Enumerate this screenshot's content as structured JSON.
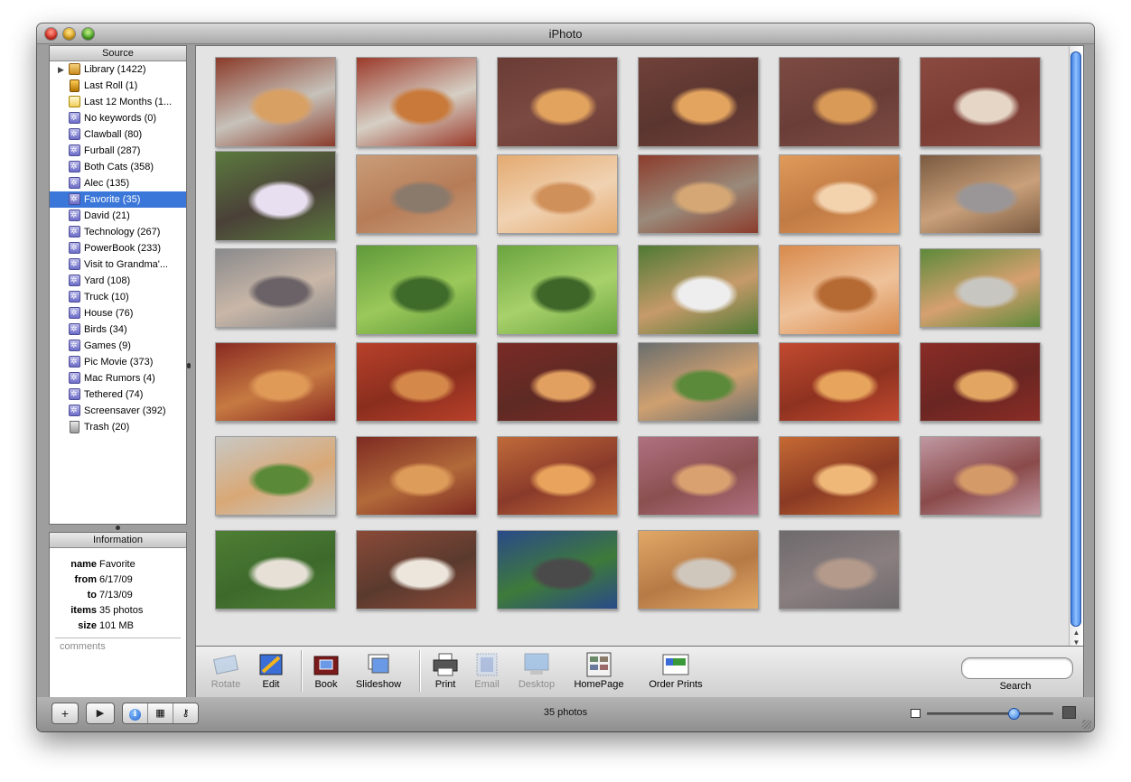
{
  "window": {
    "title": "iPhoto"
  },
  "source": {
    "header": "Source",
    "items": [
      {
        "label": "Library (1422)",
        "icon": "library-icon",
        "kind": "library"
      },
      {
        "label": "Last Roll (1)",
        "icon": "film-roll-icon",
        "kind": "roll"
      },
      {
        "label": "Last 12 Months (1...",
        "icon": "calendar-icon",
        "kind": "calendar"
      },
      {
        "label": "No keywords (0)",
        "icon": "smart-album-icon",
        "kind": "album"
      },
      {
        "label": "Clawball (80)",
        "icon": "smart-album-icon",
        "kind": "album"
      },
      {
        "label": "Furball (287)",
        "icon": "smart-album-icon",
        "kind": "album"
      },
      {
        "label": "Both Cats (358)",
        "icon": "smart-album-icon",
        "kind": "album"
      },
      {
        "label": "Alec (135)",
        "icon": "smart-album-icon",
        "kind": "album"
      },
      {
        "label": "Favorite (35)",
        "icon": "smart-album-icon",
        "kind": "album",
        "selected": true
      },
      {
        "label": "David (21)",
        "icon": "smart-album-icon",
        "kind": "album"
      },
      {
        "label": "Technology (267)",
        "icon": "smart-album-icon",
        "kind": "album"
      },
      {
        "label": "PowerBook (233)",
        "icon": "smart-album-icon",
        "kind": "album"
      },
      {
        "label": "Visit to Grandma'...",
        "icon": "smart-album-icon",
        "kind": "album"
      },
      {
        "label": "Yard (108)",
        "icon": "smart-album-icon",
        "kind": "album"
      },
      {
        "label": "Truck (10)",
        "icon": "smart-album-icon",
        "kind": "album"
      },
      {
        "label": "House (76)",
        "icon": "smart-album-icon",
        "kind": "album"
      },
      {
        "label": "Birds (34)",
        "icon": "smart-album-icon",
        "kind": "album"
      },
      {
        "label": "Games (9)",
        "icon": "smart-album-icon",
        "kind": "album"
      },
      {
        "label": "Pic Movie (373)",
        "icon": "smart-album-icon",
        "kind": "album"
      },
      {
        "label": "Mac Rumors (4)",
        "icon": "smart-album-icon",
        "kind": "album"
      },
      {
        "label": "Tethered (74)",
        "icon": "smart-album-icon",
        "kind": "album"
      },
      {
        "label": "Screensaver (392)",
        "icon": "smart-album-icon",
        "kind": "album"
      },
      {
        "label": "Trash (20)",
        "icon": "trash-icon",
        "kind": "trash"
      }
    ]
  },
  "information": {
    "header": "Information",
    "rows": [
      {
        "label": "name",
        "value": "Favorite"
      },
      {
        "label": "from",
        "value": "6/17/09"
      },
      {
        "label": "to",
        "value": "7/13/09"
      },
      {
        "label": "items",
        "value": "35 photos"
      },
      {
        "label": "size",
        "value": "101 MB"
      }
    ],
    "comments_placeholder": "comments"
  },
  "photos": {
    "count": 35,
    "thumbnails": [
      {
        "name": "photo-01",
        "subject": "orange cat on brick steps",
        "colors": [
          "#8a3b2a",
          "#d9a064",
          "#c7c2ba"
        ]
      },
      {
        "name": "photo-02",
        "subject": "orange cat on porch steps",
        "colors": [
          "#9b3a2a",
          "#c97a3a",
          "#d6cfc4"
        ]
      },
      {
        "name": "photo-03",
        "subject": "orange cat lying on deck",
        "colors": [
          "#6a3c35",
          "#e2a35e",
          "#7b4a42"
        ]
      },
      {
        "name": "photo-04",
        "subject": "orange cat stretching on deck",
        "colors": [
          "#70423a",
          "#e3a45f",
          "#5a352f"
        ]
      },
      {
        "name": "photo-05",
        "subject": "orange cat lying on deck",
        "colors": [
          "#7c4b43",
          "#d99a57",
          "#6a3e37"
        ]
      },
      {
        "name": "photo-06",
        "subject": "cat lying on red deck",
        "colors": [
          "#8a4a40",
          "#e6d6c6",
          "#7b3c34"
        ]
      },
      {
        "name": "photo-07",
        "subject": "boy holding gray cat",
        "colors": [
          "#5b7a3e",
          "#e8dff0",
          "#4a4038"
        ]
      },
      {
        "name": "photo-08",
        "subject": "gray cat by window blinds",
        "colors": [
          "#c99d78",
          "#8a7a6c",
          "#b67c58"
        ]
      },
      {
        "name": "photo-09",
        "subject": "orange cat closeup",
        "colors": [
          "#e4aa70",
          "#d0905a",
          "#f0d2b2"
        ]
      },
      {
        "name": "photo-10",
        "subject": "orange cat by brick wall",
        "colors": [
          "#8c3c2c",
          "#d5a774",
          "#9a8a7a"
        ]
      },
      {
        "name": "photo-11",
        "subject": "orange cat face closeup",
        "colors": [
          "#e09a5a",
          "#f3d2ae",
          "#c07a44"
        ]
      },
      {
        "name": "photo-12",
        "subject": "gray cat near patio chair",
        "colors": [
          "#7a5a40",
          "#9a9698",
          "#c9a07a"
        ]
      },
      {
        "name": "photo-13",
        "subject": "gray calico cat face",
        "colors": [
          "#8a8a8c",
          "#6a6266",
          "#c9b7a8"
        ]
      },
      {
        "name": "photo-14",
        "subject": "cat hidden in green leaves",
        "colors": [
          "#5f9a3a",
          "#3e6a2a",
          "#9bc85a"
        ]
      },
      {
        "name": "photo-15",
        "subject": "cat in green plants",
        "colors": [
          "#6aa43f",
          "#3d6628",
          "#a8d16a"
        ]
      },
      {
        "name": "photo-16",
        "subject": "cat near white flower pots",
        "colors": [
          "#4f7a34",
          "#eeeeee",
          "#c69a6a"
        ]
      },
      {
        "name": "photo-17",
        "subject": "orange cat sleeping",
        "colors": [
          "#d88a4c",
          "#b56a34",
          "#efc29a"
        ]
      },
      {
        "name": "photo-18",
        "subject": "cat on sidewalk by lawn",
        "colors": [
          "#5d8a3a",
          "#c8c6c0",
          "#d6a070"
        ]
      },
      {
        "name": "photo-19",
        "subject": "orange cat on red rug",
        "colors": [
          "#8a2a22",
          "#e09a58",
          "#c67a42"
        ]
      },
      {
        "name": "photo-20",
        "subject": "cat on red chair",
        "colors": [
          "#b8402a",
          "#d4884a",
          "#8a2e1e"
        ]
      },
      {
        "name": "photo-21",
        "subject": "orange cat lying on rug",
        "colors": [
          "#7a2a26",
          "#e2a060",
          "#5e2a24"
        ]
      },
      {
        "name": "photo-22",
        "subject": "cat on driveway",
        "colors": [
          "#6a6e6e",
          "#5a8a3a",
          "#cfa070"
        ]
      },
      {
        "name": "photo-23",
        "subject": "orange cat in red chair",
        "colors": [
          "#c24a30",
          "#e7a45c",
          "#8e3220"
        ]
      },
      {
        "name": "photo-24",
        "subject": "orange cat lying on rug",
        "colors": [
          "#8a2c26",
          "#e3a662",
          "#6a2622"
        ]
      },
      {
        "name": "photo-25",
        "subject": "cat walking on sidewalk",
        "colors": [
          "#c8c8c4",
          "#5a8a38",
          "#d9a876"
        ]
      },
      {
        "name": "photo-26",
        "subject": "orange cat sleeping on red rug",
        "colors": [
          "#7e2a22",
          "#de9c5a",
          "#b26a3a"
        ]
      },
      {
        "name": "photo-27",
        "subject": "orange cat profile",
        "colors": [
          "#c06a3a",
          "#e9a35c",
          "#8a3a2a"
        ]
      },
      {
        "name": "photo-28",
        "subject": "cat on patterned rug",
        "colors": [
          "#b07080",
          "#d9a070",
          "#8a5050"
        ]
      },
      {
        "name": "photo-29",
        "subject": "orange cat face",
        "colors": [
          "#c66a34",
          "#f0b878",
          "#8a3a24"
        ]
      },
      {
        "name": "photo-30",
        "subject": "cat standing on rug",
        "colors": [
          "#c098a2",
          "#d49a68",
          "#8a4a4a"
        ]
      },
      {
        "name": "photo-31",
        "subject": "cat in yard grass",
        "colors": [
          "#4f7e34",
          "#e6e0d6",
          "#3d6a2c"
        ]
      },
      {
        "name": "photo-32",
        "subject": "cat drinking from bowl",
        "colors": [
          "#8a4a38",
          "#ede6dc",
          "#5a3a2e"
        ]
      },
      {
        "name": "photo-33",
        "subject": "tortoiseshell cat on blue chair",
        "colors": [
          "#2a4a88",
          "#4a4a4a",
          "#3e7a3a"
        ]
      },
      {
        "name": "photo-34",
        "subject": "orange cat on newspaper",
        "colors": [
          "#e0a866",
          "#cfc6bc",
          "#b67a46"
        ]
      },
      {
        "name": "photo-35",
        "subject": "gray cat face",
        "colors": [
          "#6e6a6c",
          "#b39a8a",
          "#8a7e80"
        ]
      }
    ]
  },
  "toolbar": {
    "tools": [
      {
        "label": "Rotate",
        "icon": "rotate-icon",
        "enabled": false
      },
      {
        "label": "Edit",
        "icon": "edit-icon",
        "enabled": true
      },
      {
        "label": "Book",
        "icon": "book-icon",
        "enabled": true
      },
      {
        "label": "Slideshow",
        "icon": "slideshow-icon",
        "enabled": true
      },
      {
        "label": "Print",
        "icon": "print-icon",
        "enabled": true
      },
      {
        "label": "Email",
        "icon": "email-icon",
        "enabled": false
      },
      {
        "label": "Desktop",
        "icon": "desktop-icon",
        "enabled": false
      },
      {
        "label": "HomePage",
        "icon": "homepage-icon",
        "enabled": true
      },
      {
        "label": "Order Prints",
        "icon": "order-prints-icon",
        "enabled": true
      }
    ],
    "search_label": "Search",
    "search_value": ""
  },
  "bottom_bar": {
    "add_button": "+",
    "play_button": "▶",
    "info_glyph": "i",
    "calendar_glyph": "▦",
    "keywords_glyph": "⚷",
    "status": "35 photos",
    "zoom_level": 0.7
  },
  "colors": {
    "selection": "#3b77d9",
    "scroller": "#2d6fd9",
    "album_icon": "#7a7ad0"
  }
}
